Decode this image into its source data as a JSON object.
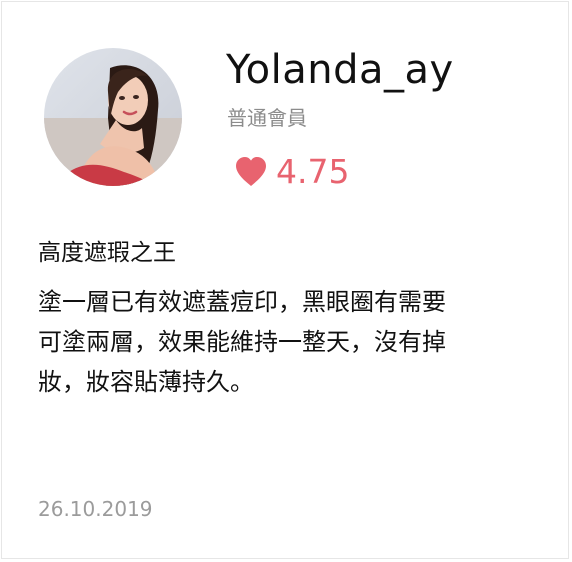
{
  "user": {
    "name": "Yolanda_ay",
    "membership": "普通會員",
    "avatar_icon": "user-avatar-photo"
  },
  "rating": {
    "icon": "heart-icon",
    "value": "4.75",
    "color": "#e8636f"
  },
  "review": {
    "title": "高度遮瑕之王",
    "body_lines": [
      "塗一層已有效遮蓋痘印，黑眼圈有需要",
      "可塗兩層，效果能維持一整天，沒有掉",
      "妝，妝容貼薄持久。"
    ],
    "date": "26.10.2019"
  }
}
